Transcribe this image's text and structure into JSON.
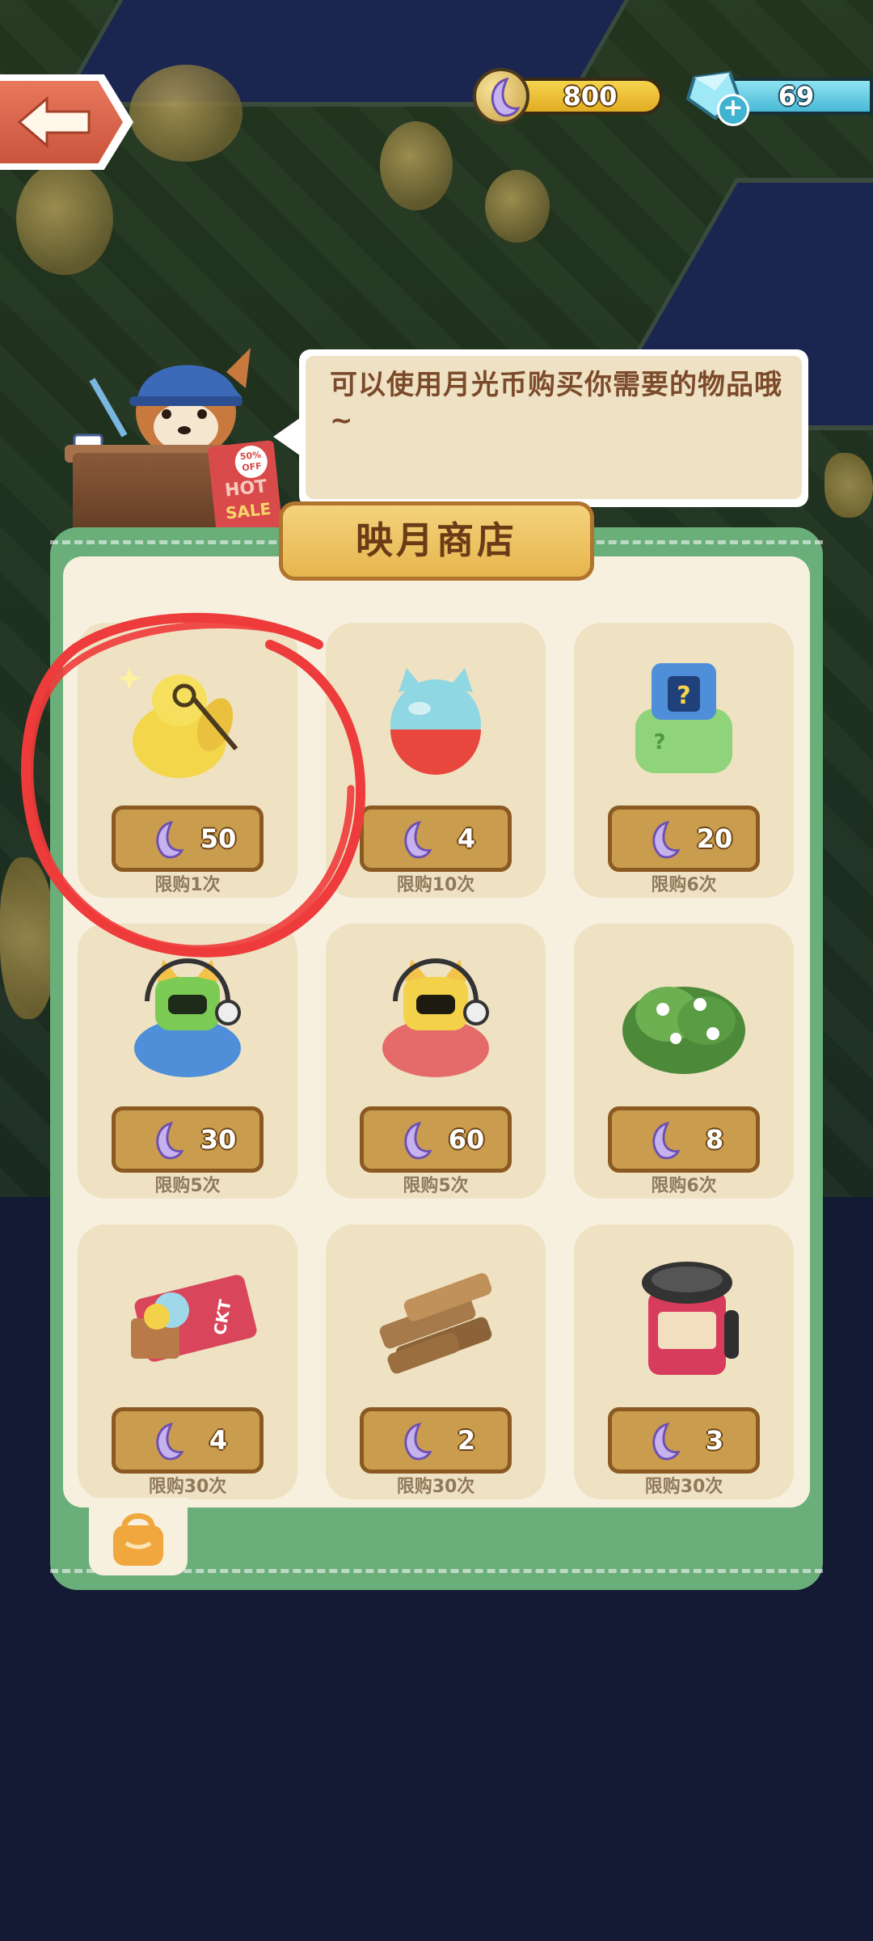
{
  "currencies": {
    "moon_coins": "800",
    "gems": "69"
  },
  "shopkeeper": {
    "sign_percent": "50%",
    "sign_off": "OFF",
    "sign_hot": "HOT",
    "sign_sale": "SALE"
  },
  "speech": {
    "text": "可以使用月光币购买你需要的物品哦~"
  },
  "shop": {
    "title": "映月商店",
    "items": [
      {
        "price": "50",
        "limit": "限购1次",
        "icon": "golden-gourd-icon"
      },
      {
        "price": "4",
        "limit": "限购10次",
        "icon": "cat-capsule-icon"
      },
      {
        "price": "20",
        "limit": "限购6次",
        "icon": "mystery-bag-icon"
      },
      {
        "price": "30",
        "limit": "限购5次",
        "icon": "blue-robot-cat-icon"
      },
      {
        "price": "60",
        "limit": "限购5次",
        "icon": "red-robot-cat-icon"
      },
      {
        "price": "8",
        "limit": "限购6次",
        "icon": "flower-bush-icon"
      },
      {
        "price": "4",
        "limit": "限购30次",
        "icon": "ticket-icon"
      },
      {
        "price": "2",
        "limit": "限购30次",
        "icon": "wood-logs-icon"
      },
      {
        "price": "3",
        "limit": "限购30次",
        "icon": "jam-jar-icon"
      }
    ]
  },
  "colors": {
    "panel_green": "#6aae7a",
    "card_bg": "#efe2c3",
    "price_plate": "#c99d4d",
    "highlight_circle": "#ee3b3b"
  }
}
